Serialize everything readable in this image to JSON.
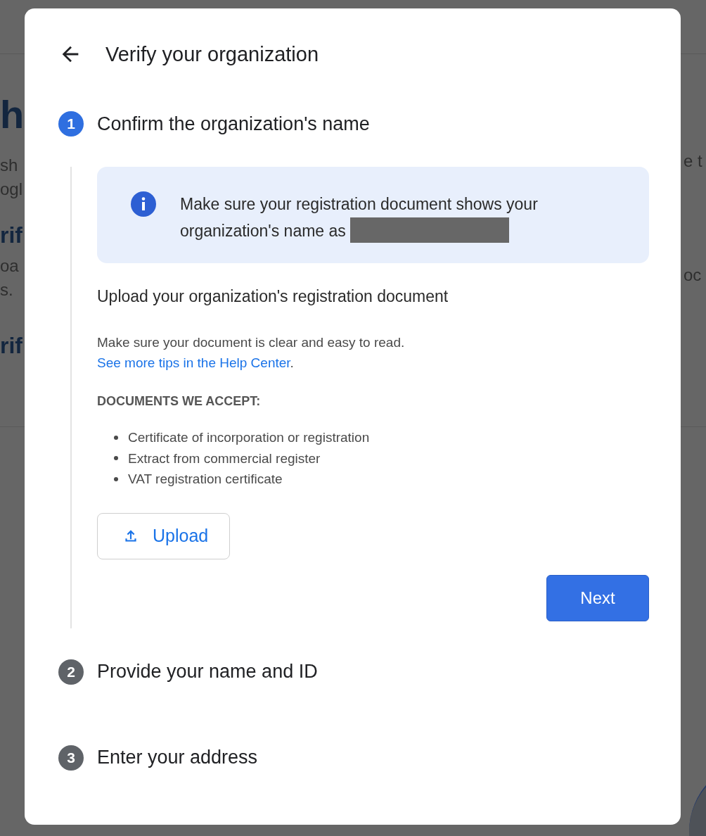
{
  "background_page": {
    "left_fragments": [
      {
        "kind": "heading",
        "text": "h"
      },
      {
        "kind": "body",
        "text": "sh"
      },
      {
        "kind": "body",
        "text": "ogl"
      },
      {
        "kind": "subheading",
        "text": "rif"
      },
      {
        "kind": "body",
        "text": "oa"
      },
      {
        "kind": "body",
        "text": "s."
      },
      {
        "kind": "subheading",
        "text": "rif"
      }
    ],
    "right_fragments": [
      {
        "kind": "body",
        "text": "e t"
      },
      {
        "kind": "body",
        "text": "oc"
      }
    ]
  },
  "dialog": {
    "title": "Verify your organization",
    "steps": [
      {
        "number": "1",
        "title": "Confirm the organization's name",
        "selected": true,
        "info": {
          "text": "Make sure your registration document shows your organization's name as",
          "redacted": true
        },
        "upload_heading": "Upload your organization's registration document",
        "tip": "Make sure your document is clear and easy to read.",
        "tip_link": "See more tips in the Help Center",
        "tip_end": ".",
        "documents_heading": "DOCUMENTS WE ACCEPT:",
        "documents": [
          "Certificate of incorporation or registration",
          "Extract from commercial register",
          "VAT registration certificate"
        ],
        "upload_button": "Upload",
        "next_button": "Next"
      },
      {
        "number": "2",
        "title": "Provide your name and ID",
        "selected": false
      },
      {
        "number": "3",
        "title": "Enter your address",
        "selected": false
      }
    ]
  }
}
